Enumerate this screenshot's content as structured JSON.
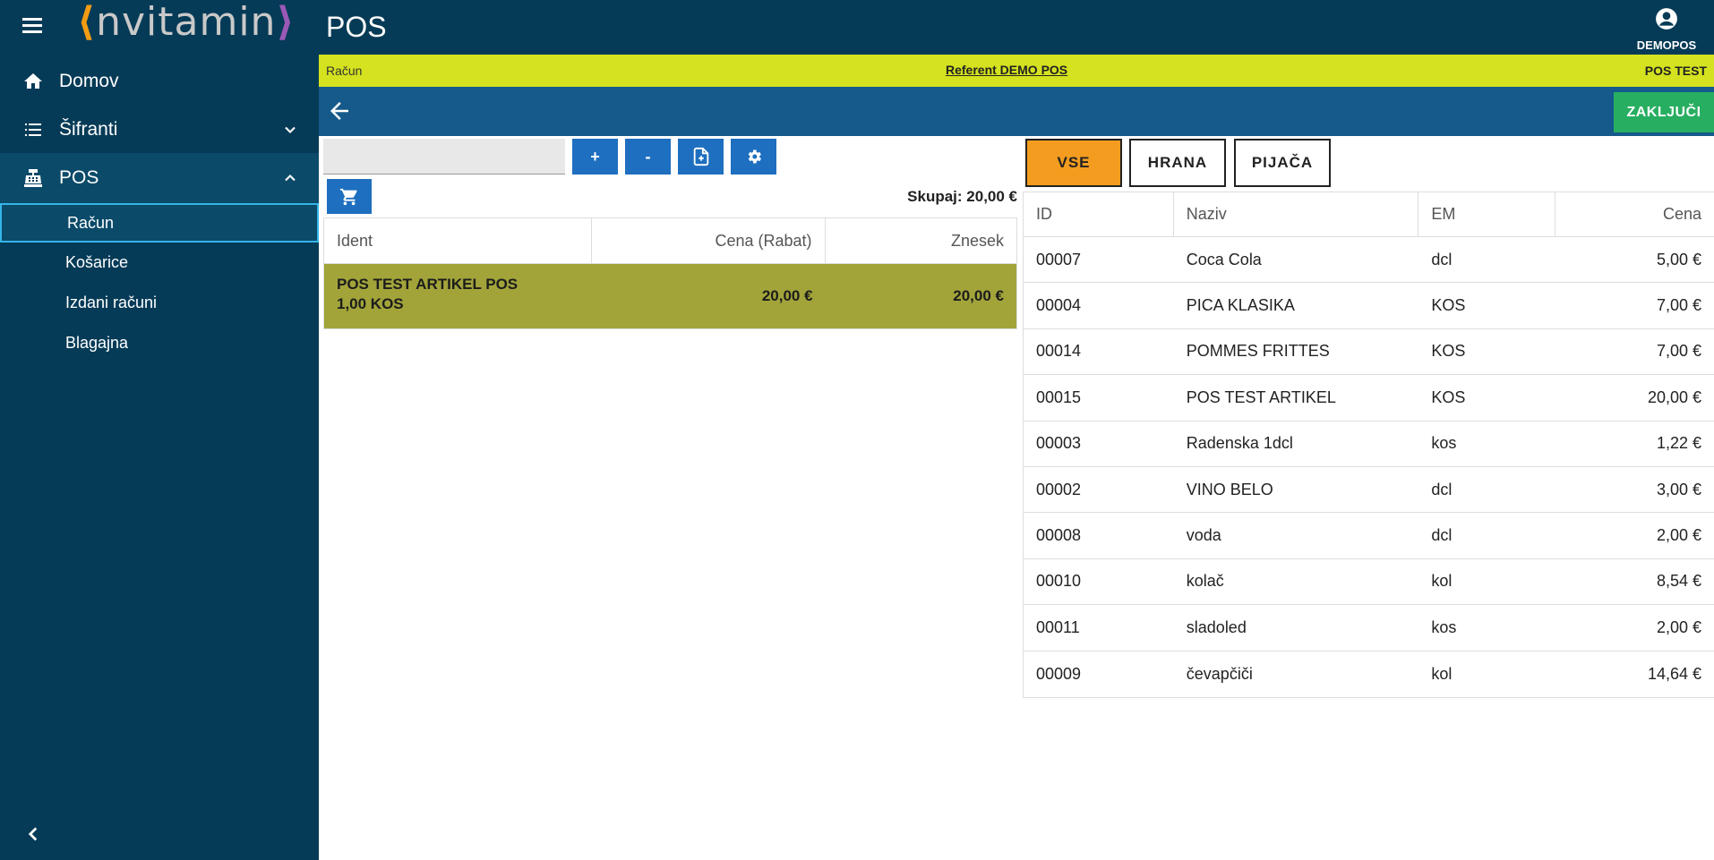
{
  "header": {
    "logo_left": "⟨",
    "logo_word": "nvitamin",
    "logo_right": "⟩",
    "title": "POS",
    "user_name": "DEMOPOS"
  },
  "sidebar": {
    "items": [
      {
        "label": "Domov",
        "icon": "home-icon"
      },
      {
        "label": "Šifranti",
        "icon": "list-icon"
      },
      {
        "label": "POS",
        "icon": "cash-register-icon"
      }
    ],
    "subitems": [
      {
        "label": "Račun",
        "active": true
      },
      {
        "label": "Košarice"
      },
      {
        "label": "Izdani računi"
      },
      {
        "label": "Blagajna"
      }
    ]
  },
  "infobar": {
    "left": "Račun",
    "center": "Referent DEMO POS",
    "right": "POS TEST"
  },
  "actionbar": {
    "finish_label": "ZAKLJUČI"
  },
  "toolbar": {
    "search_value": "",
    "plus_label": "+",
    "minus_label": "-"
  },
  "cart": {
    "total_label": "Skupaj: 20,00 €",
    "columns": [
      "Ident",
      "Cena (Rabat)",
      "Znesek"
    ],
    "rows": [
      {
        "name": "POS TEST ARTIKEL POS",
        "qty": "1,00 KOS",
        "price": "20,00 €",
        "amount": "20,00 €"
      }
    ]
  },
  "categories": [
    {
      "label": "VSE",
      "active": true
    },
    {
      "label": "HRANA"
    },
    {
      "label": "PIJAČA"
    }
  ],
  "products": {
    "columns": [
      "ID",
      "Naziv",
      "EM",
      "Cena"
    ],
    "rows": [
      {
        "id": "00007",
        "name": "Coca Cola",
        "unit": "dcl",
        "price": "5,00 €"
      },
      {
        "id": "00004",
        "name": "PICA KLASIKA",
        "unit": "KOS",
        "price": "7,00 €"
      },
      {
        "id": "00014",
        "name": "POMMES FRITTES",
        "unit": "KOS",
        "price": "7,00 €"
      },
      {
        "id": "00015",
        "name": "POS TEST ARTIKEL",
        "unit": "KOS",
        "price": "20,00 €"
      },
      {
        "id": "00003",
        "name": "Radenska 1dcl",
        "unit": "kos",
        "price": "1,22 €"
      },
      {
        "id": "00002",
        "name": "VINO BELO",
        "unit": "dcl",
        "price": "3,00 €"
      },
      {
        "id": "00008",
        "name": "voda",
        "unit": "dcl",
        "price": "2,00 €"
      },
      {
        "id": "00010",
        "name": "kolač",
        "unit": "kol",
        "price": "8,54 €"
      },
      {
        "id": "00011",
        "name": "sladoled",
        "unit": "kos",
        "price": "2,00 €"
      },
      {
        "id": "00009",
        "name": "čevapčiči",
        "unit": "kol",
        "price": "14,64 €"
      }
    ]
  },
  "colors": {
    "nav_bg": "#063b57",
    "info_bar": "#d4e21f",
    "action_bar": "#155a8a",
    "button_blue": "#1e6fbf",
    "finish_green": "#27ae60",
    "cart_row": "#a2a43a",
    "category_active": "#f39c1f"
  }
}
